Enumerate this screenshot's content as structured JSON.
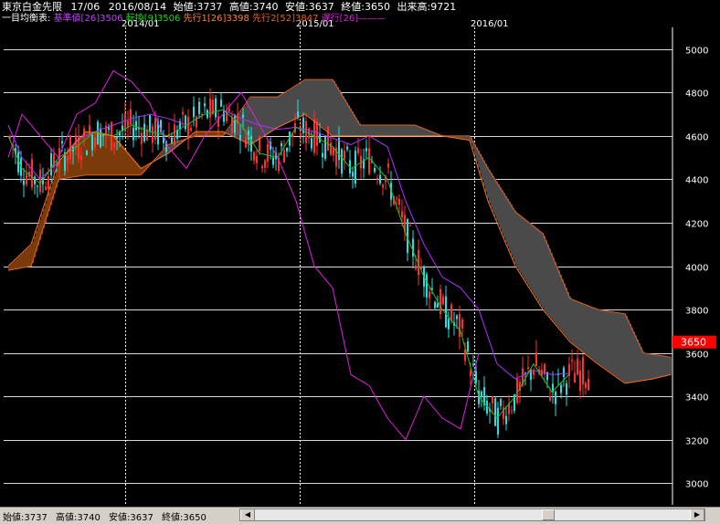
{
  "header": {
    "symbol": "東京白金先限",
    "contract": "17/06",
    "date": "2016/08/14",
    "open_label": "始値:",
    "open": "3737",
    "high_label": "高値:",
    "high": "3740",
    "low_label": "安値:",
    "low": "3637",
    "close_label": "終値:",
    "close": "3650",
    "volume_label": "出来高:",
    "volume": "9721"
  },
  "indicator": {
    "title": "一目均衡表:",
    "kijun_label": "基準値[26]",
    "kijun_value": "3506",
    "tenkan_label": "転換[9]",
    "tenkan_value": "3506",
    "senkou1_label": "先行1[26]",
    "senkou1_value": "3398",
    "senkou2_label": "先行2[52]",
    "senkou2_value": "3847",
    "chikou_label": "遅行[26]"
  },
  "colors": {
    "background": "#000000",
    "grid": "#ffffff",
    "up_candle": "#ff3030",
    "down_candle": "#22e0e0",
    "kijun": "#b030ff",
    "tenkan": "#20c020",
    "senkou1": "#ff7020",
    "senkou2": "#e06020",
    "chikou": "#e020e0",
    "cloud_bull": "#7a3a0a",
    "cloud_bear": "#4a4a4a",
    "price_tag": "#ff0000"
  },
  "status_bar": {
    "open_label": "始値:",
    "open": "3737",
    "high_label": "高値:",
    "high": "3740",
    "low_label": "安値:",
    "low": "3637",
    "close_label": "終値:",
    "close": "3650"
  },
  "chart_data": {
    "type": "line",
    "x_tick_labels": [
      "2014/01",
      "2015/01",
      "2016/01"
    ],
    "ylim": [
      2900,
      5100
    ],
    "y_ticks": [
      3000,
      3200,
      3400,
      3600,
      3800,
      4000,
      4200,
      4400,
      4600,
      4800,
      5000
    ],
    "current_price": 3650,
    "grid": true,
    "series": [
      {
        "name": "基準値[26]",
        "points": [
          [
            5,
            4650
          ],
          [
            20,
            4500
          ],
          [
            40,
            4400
          ],
          [
            60,
            4480
          ],
          [
            80,
            4580
          ],
          [
            100,
            4620
          ],
          [
            120,
            4650
          ],
          [
            140,
            4680
          ],
          [
            160,
            4700
          ],
          [
            180,
            4680
          ],
          [
            200,
            4650
          ],
          [
            220,
            4700
          ],
          [
            240,
            4720
          ],
          [
            260,
            4680
          ],
          [
            280,
            4650
          ],
          [
            300,
            4630
          ],
          [
            320,
            4640
          ],
          [
            340,
            4620
          ],
          [
            360,
            4590
          ],
          [
            380,
            4560
          ],
          [
            400,
            4600
          ],
          [
            420,
            4550
          ],
          [
            440,
            4300
          ],
          [
            460,
            4100
          ],
          [
            480,
            3950
          ],
          [
            500,
            3900
          ],
          [
            520,
            3800
          ],
          [
            540,
            3550
          ],
          [
            560,
            3480
          ],
          [
            580,
            3520
          ],
          [
            600,
            3500
          ],
          [
            620,
            3506
          ]
        ]
      },
      {
        "name": "転換[9]",
        "points": [
          [
            5,
            4600
          ],
          [
            20,
            4450
          ],
          [
            40,
            4380
          ],
          [
            60,
            4500
          ],
          [
            80,
            4550
          ],
          [
            100,
            4620
          ],
          [
            120,
            4600
          ],
          [
            140,
            4650
          ],
          [
            160,
            4620
          ],
          [
            180,
            4600
          ],
          [
            200,
            4650
          ],
          [
            220,
            4700
          ],
          [
            240,
            4720
          ],
          [
            260,
            4650
          ],
          [
            280,
            4520
          ],
          [
            300,
            4500
          ],
          [
            320,
            4640
          ],
          [
            340,
            4600
          ],
          [
            360,
            4550
          ],
          [
            380,
            4450
          ],
          [
            400,
            4500
          ],
          [
            420,
            4400
          ],
          [
            440,
            4150
          ],
          [
            460,
            3950
          ],
          [
            480,
            3800
          ],
          [
            500,
            3700
          ],
          [
            520,
            3400
          ],
          [
            540,
            3300
          ],
          [
            560,
            3400
          ],
          [
            580,
            3550
          ],
          [
            600,
            3420
          ],
          [
            620,
            3506
          ]
        ]
      },
      {
        "name": "先行1[26]",
        "points": [
          [
            5,
            4000
          ],
          [
            30,
            4100
          ],
          [
            60,
            4480
          ],
          [
            90,
            4620
          ],
          [
            120,
            4600
          ],
          [
            150,
            4450
          ],
          [
            180,
            4520
          ],
          [
            210,
            4620
          ],
          [
            240,
            4620
          ],
          [
            270,
            4560
          ],
          [
            300,
            4640
          ],
          [
            330,
            4700
          ],
          [
            360,
            4600
          ],
          [
            390,
            4600
          ],
          [
            420,
            4600
          ],
          [
            450,
            4600
          ],
          [
            480,
            4600
          ],
          [
            510,
            4580
          ],
          [
            530,
            4300
          ],
          [
            560,
            4000
          ],
          [
            590,
            3800
          ],
          [
            620,
            3650
          ],
          [
            650,
            3550
          ],
          [
            680,
            3460
          ],
          [
            710,
            3480
          ],
          [
            730,
            3500
          ]
        ]
      },
      {
        "name": "先行2[52]",
        "points": [
          [
            5,
            3980
          ],
          [
            30,
            4000
          ],
          [
            60,
            4400
          ],
          [
            90,
            4420
          ],
          [
            120,
            4420
          ],
          [
            150,
            4420
          ],
          [
            180,
            4560
          ],
          [
            210,
            4600
          ],
          [
            240,
            4600
          ],
          [
            270,
            4780
          ],
          [
            300,
            4780
          ],
          [
            330,
            4860
          ],
          [
            360,
            4860
          ],
          [
            390,
            4650
          ],
          [
            420,
            4650
          ],
          [
            450,
            4650
          ],
          [
            480,
            4600
          ],
          [
            510,
            4600
          ],
          [
            530,
            4450
          ],
          [
            560,
            4250
          ],
          [
            590,
            4150
          ],
          [
            620,
            3850
          ],
          [
            650,
            3800
          ],
          [
            680,
            3780
          ],
          [
            700,
            3600
          ],
          [
            730,
            3580
          ]
        ]
      },
      {
        "name": "遅行[26]",
        "points": [
          [
            5,
            4500
          ],
          [
            20,
            4700
          ],
          [
            40,
            4600
          ],
          [
            60,
            4500
          ],
          [
            80,
            4700
          ],
          [
            100,
            4750
          ],
          [
            120,
            4900
          ],
          [
            140,
            4850
          ],
          [
            160,
            4750
          ],
          [
            180,
            4550
          ],
          [
            200,
            4450
          ],
          [
            220,
            4600
          ],
          [
            240,
            4700
          ],
          [
            260,
            4800
          ],
          [
            280,
            4650
          ],
          [
            300,
            4500
          ],
          [
            320,
            4300
          ],
          [
            340,
            4000
          ],
          [
            360,
            3900
          ],
          [
            380,
            3500
          ],
          [
            400,
            3450
          ],
          [
            420,
            3300
          ],
          [
            440,
            3200
          ],
          [
            460,
            3400
          ],
          [
            480,
            3300
          ],
          [
            500,
            3250
          ],
          [
            520,
            3600
          ]
        ]
      }
    ]
  }
}
